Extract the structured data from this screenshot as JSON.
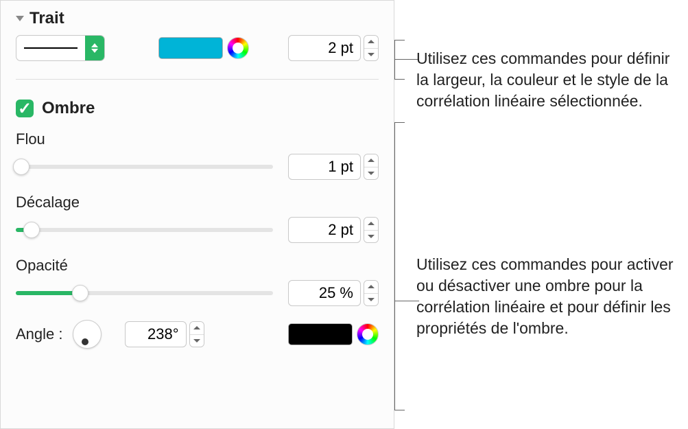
{
  "trait": {
    "section_label": "Trait",
    "stroke_color": "#00b4d7",
    "width_value": "2 pt"
  },
  "shadow": {
    "section_label": "Ombre",
    "checked": true,
    "blur": {
      "label": "Flou",
      "value": "1 pt",
      "percent": 2
    },
    "offset": {
      "label": "Décalage",
      "value": "2 pt",
      "percent": 6
    },
    "opacity": {
      "label": "Opacité",
      "value": "25 %",
      "percent": 25
    },
    "angle": {
      "label": "Angle :",
      "value": "238°"
    },
    "color": "#000000"
  },
  "annotations": {
    "top": "Utilisez ces commandes pour définir la largeur, la couleur et le style de la corrélation linéaire sélectionnée.",
    "bottom": "Utilisez ces commandes pour activer ou désactiver une ombre pour la corrélation linéaire et pour définir les propriétés de l'ombre."
  }
}
